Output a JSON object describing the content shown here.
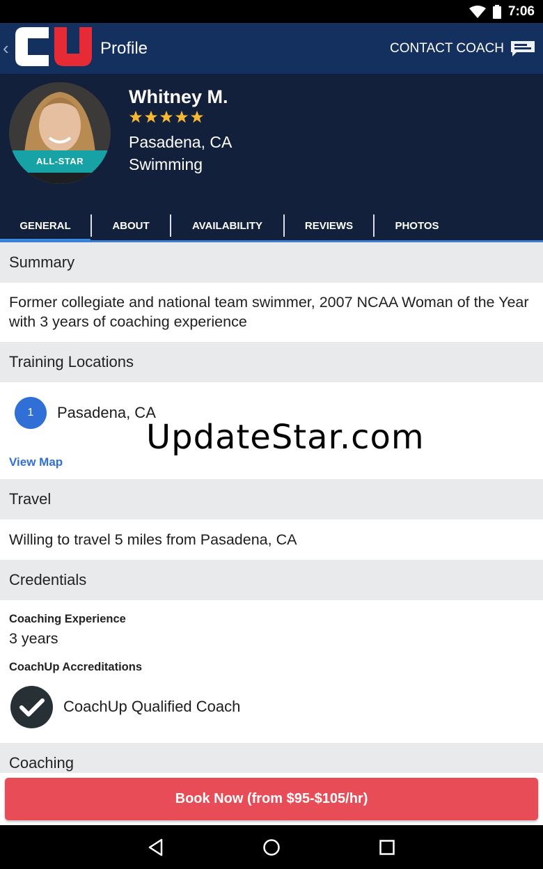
{
  "status_bar": {
    "time": "7:06"
  },
  "app_bar": {
    "title": "Profile",
    "contact_label": "CONTACT COACH"
  },
  "coach": {
    "name": "Whitney M.",
    "rating": 5,
    "location": "Pasadena, CA",
    "sport": "Swimming",
    "badge": "ALL-STAR"
  },
  "tabs": [
    "GENERAL",
    "ABOUT",
    "AVAILABILITY",
    "REVIEWS",
    "PHOTOS"
  ],
  "active_tab": "GENERAL",
  "summary": {
    "heading": "Summary",
    "text": "Former collegiate and national team swimmer, 2007 NCAA Woman of the Year with 3 years of coaching experience"
  },
  "training": {
    "heading": "Training Locations",
    "locations": [
      {
        "num": "1",
        "name": "Pasadena, CA"
      }
    ],
    "view_map": "View Map"
  },
  "watermark": "UpdateStar.com",
  "travel": {
    "heading": "Travel",
    "text": "Willing to travel 5 miles from Pasadena, CA"
  },
  "credentials": {
    "heading": "Credentials",
    "experience_label": "Coaching Experience",
    "experience_value": "3 years",
    "accreditations_label": "CoachUp Accreditations",
    "accreditation": "CoachUp Qualified Coach"
  },
  "coaching": {
    "heading": "Coaching"
  },
  "book_button": "Book Now (from $95-$105/hr)",
  "colors": {
    "app_bar": "#14305e",
    "header_bg": "#13203b",
    "accent_blue": "#2f6fd6",
    "book_red": "#e84d57",
    "star_gold": "#f7b731",
    "badge_teal": "#17a3a5"
  }
}
